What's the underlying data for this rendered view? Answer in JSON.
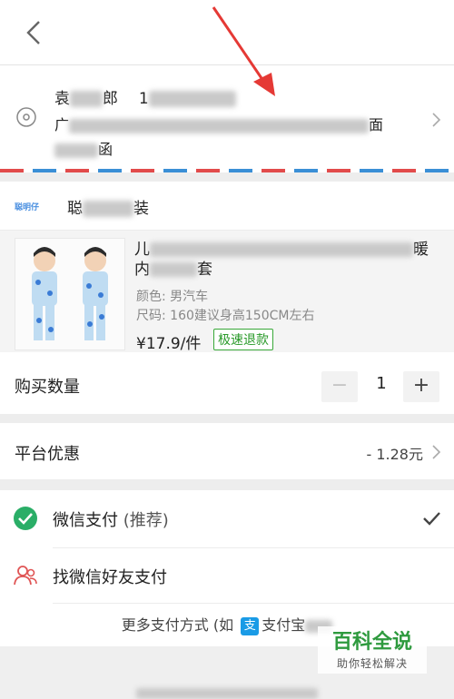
{
  "header": {
    "back_icon": "chevron-left-icon"
  },
  "address": {
    "name_start": "袁",
    "name_end": "郎",
    "phone_start": "1",
    "street_start": "广",
    "street_end": "面",
    "line3_end": "函",
    "icon": "location-icon"
  },
  "shop": {
    "logo_text": "聪明仔",
    "name_start": "聪",
    "name_end": "装"
  },
  "product": {
    "title_start": "儿",
    "title_end": "暖",
    "title_line2": "内",
    "title_line2_end": "套",
    "color_spec": "颜色: 男汽车",
    "size_spec": "尺码: 160建议身高150CM左右",
    "price": "¥17.9/件",
    "badge": "极速退款"
  },
  "quantity": {
    "label": "购买数量",
    "minus": "−",
    "value": "1",
    "plus": "+"
  },
  "discount": {
    "label": "平台优惠",
    "value": "- 1.28元"
  },
  "payment": {
    "wechat_label": "微信支付",
    "wechat_recommend": "(推荐)",
    "friend_label": "找微信好友支付",
    "more_prefix": "更多支付方式 (如",
    "alipay_icon_text": "支",
    "alipay_label": "支付宝"
  },
  "watermark": {
    "title": "百科全说",
    "subtitle": "助你轻松解决"
  },
  "colors": {
    "wechat_green": "#2aae67",
    "air_mail_red": "#e24b4b",
    "air_mail_blue": "#3a8fd6",
    "badge_green": "#2a9a2a",
    "annotation_red": "#e53935",
    "friend_icon_red": "#e05555",
    "alipay_blue": "#1a9be6"
  }
}
